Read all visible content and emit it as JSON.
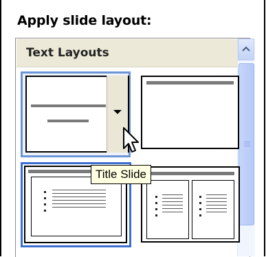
{
  "task_pane": {
    "title": "Apply slide layout:"
  },
  "gallery": {
    "category_label": "Text Layouts",
    "layouts": [
      {
        "name": "Title Slide"
      },
      {
        "name": "Title Only"
      },
      {
        "name": "Title and Text"
      },
      {
        "name": "Title and 2-Column Text"
      }
    ],
    "hovered_index": 0,
    "selected_index": 2
  },
  "tooltip": {
    "text": "Title Slide"
  },
  "icons": {
    "scroll_up": "chevron-up-icon",
    "dropdown": "caret-down-icon",
    "cursor": "arrow-cursor-icon"
  },
  "colors": {
    "hover_border": "#6b95d6",
    "selected_border": "#3a6fd0",
    "tooltip_bg": "#ffffe1",
    "header_bg": "#ece9d8"
  }
}
